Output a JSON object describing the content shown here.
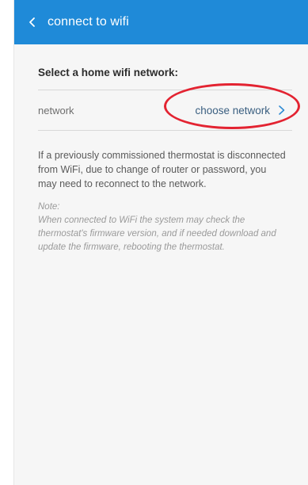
{
  "header": {
    "title": "connect to wifi",
    "back_icon": "chevron-left-icon",
    "background": "#1f8ad8"
  },
  "section": {
    "title": "Select a home wifi network:"
  },
  "network_row": {
    "label": "network",
    "action_label": "choose network",
    "action_icon": "chevron-right-icon",
    "highlight_color": "#e32331"
  },
  "info": {
    "text": "If a previously commissioned thermostat is disconnected from WiFi, due to change of router or password, you may need to reconnect to the network."
  },
  "note": {
    "label": "Note:",
    "text": "When connected to WiFi the system may check the thermostat's firmware version, and if needed download and update the firmware, rebooting the thermostat."
  }
}
